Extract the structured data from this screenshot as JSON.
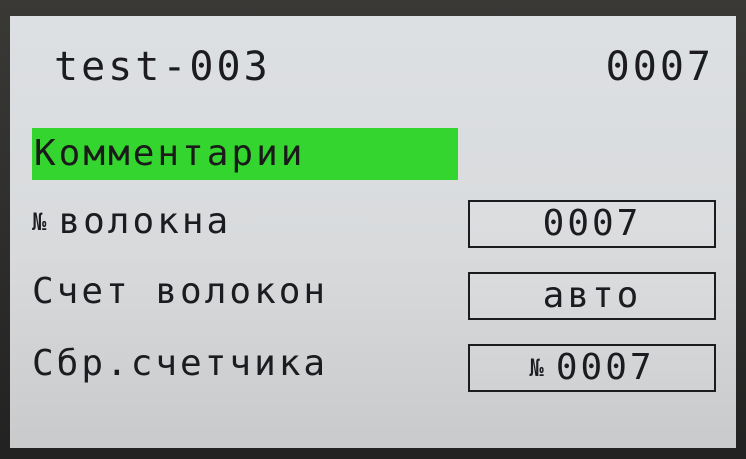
{
  "header": {
    "title": "test-003",
    "counter": "0007"
  },
  "menu": {
    "comments_label": "Комментарии",
    "fiber_number": {
      "sign": "№",
      "label": "волокна",
      "value": "0007"
    },
    "fiber_count": {
      "label": "Счет волокон",
      "value": "авто"
    },
    "counter_reset": {
      "label": "Сбр.счетчика",
      "value_sign": "№",
      "value": "0007"
    }
  },
  "colors": {
    "selection": "#34d52f",
    "screen_background": "#dcdfe2",
    "text": "#1c1c20"
  }
}
